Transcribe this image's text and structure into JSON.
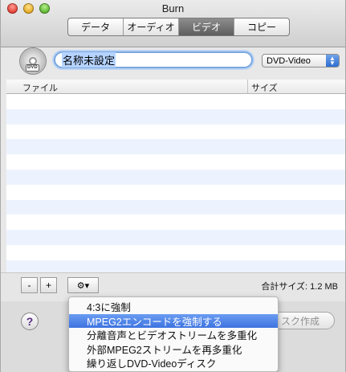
{
  "window": {
    "title": "Burn"
  },
  "tabs": [
    {
      "label": "データ",
      "active": false
    },
    {
      "label": "オーディオ",
      "active": false
    },
    {
      "label": "ビデオ",
      "active": true
    },
    {
      "label": "コピー",
      "active": false
    }
  ],
  "disc": {
    "icon": "dvd-disc-icon",
    "label": "DVD"
  },
  "name_field": {
    "value": "名称未設定"
  },
  "format_popup": {
    "selected": "DVD-Video"
  },
  "table": {
    "columns": [
      "ファイル",
      "サイズ"
    ],
    "rows": []
  },
  "toolbar": {
    "remove_label": "-",
    "add_label": "+",
    "gear_label": "⚙▾",
    "total": "合計サイズ: 1.2 MB"
  },
  "footer": {
    "help_label": "?",
    "burn_label": "ィスク作成"
  },
  "menu": {
    "items": [
      {
        "label": "4:3に強制",
        "highlighted": false
      },
      {
        "label": "MPEG2エンコードを強制する",
        "highlighted": true
      },
      {
        "label": "分離音声とビデオストリームを多重化",
        "highlighted": false
      },
      {
        "label": "外部MPEG2ストリームを再多重化",
        "highlighted": false
      },
      {
        "label": "繰り返しDVD-Videoディスク",
        "highlighted": false
      }
    ]
  }
}
